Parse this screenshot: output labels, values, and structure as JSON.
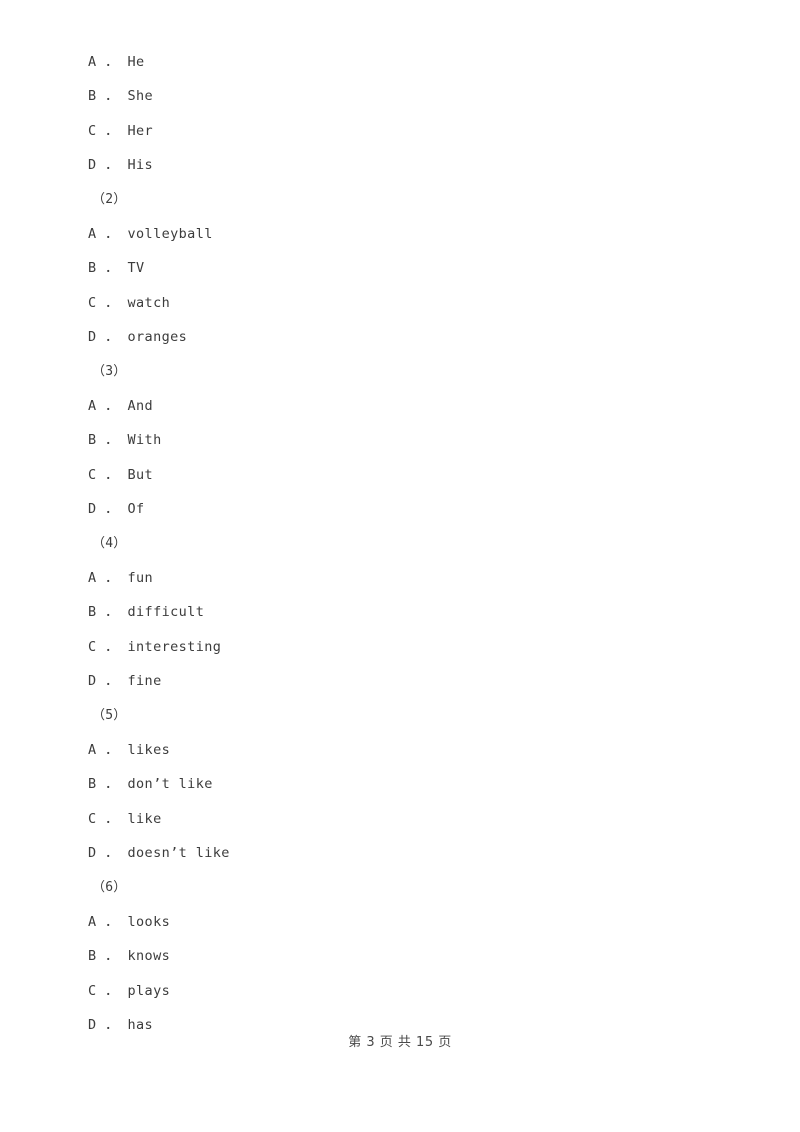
{
  "document": {
    "background_color": "#ffffff",
    "text_color": "#3c3c3c",
    "footer_color": "#4a4a4a"
  },
  "lines": [
    {
      "type": "option",
      "text": "A ． He"
    },
    {
      "type": "option",
      "text": "B ． She"
    },
    {
      "type": "option",
      "text": "C ． Her"
    },
    {
      "type": "option",
      "text": "D ． His"
    },
    {
      "type": "group",
      "text": "（2）"
    },
    {
      "type": "option",
      "text": "A ． volleyball"
    },
    {
      "type": "option",
      "text": "B ． TV"
    },
    {
      "type": "option",
      "text": "C ． watch"
    },
    {
      "type": "option",
      "text": "D ． oranges"
    },
    {
      "type": "group",
      "text": "（3）"
    },
    {
      "type": "option",
      "text": "A ． And"
    },
    {
      "type": "option",
      "text": "B ． With"
    },
    {
      "type": "option",
      "text": "C ． But"
    },
    {
      "type": "option",
      "text": "D ． Of"
    },
    {
      "type": "group",
      "text": "（4）"
    },
    {
      "type": "option",
      "text": "A ． fun"
    },
    {
      "type": "option",
      "text": "B ． difficult"
    },
    {
      "type": "option",
      "text": "C ． interesting"
    },
    {
      "type": "option",
      "text": "D ． fine"
    },
    {
      "type": "group",
      "text": "（5）"
    },
    {
      "type": "option",
      "text": "A ． likes"
    },
    {
      "type": "option",
      "text": "B ． don’t like"
    },
    {
      "type": "option",
      "text": "C ． like"
    },
    {
      "type": "option",
      "text": "D ． doesn’t like"
    },
    {
      "type": "group",
      "text": "（6）"
    },
    {
      "type": "option",
      "text": "A ． looks"
    },
    {
      "type": "option",
      "text": "B ． knows"
    },
    {
      "type": "option",
      "text": "C ． plays"
    },
    {
      "type": "option",
      "text": "D ． has"
    }
  ],
  "footer": {
    "page_label": "第 3 页 共 15 页",
    "current_page": "3",
    "total_pages": "15"
  }
}
